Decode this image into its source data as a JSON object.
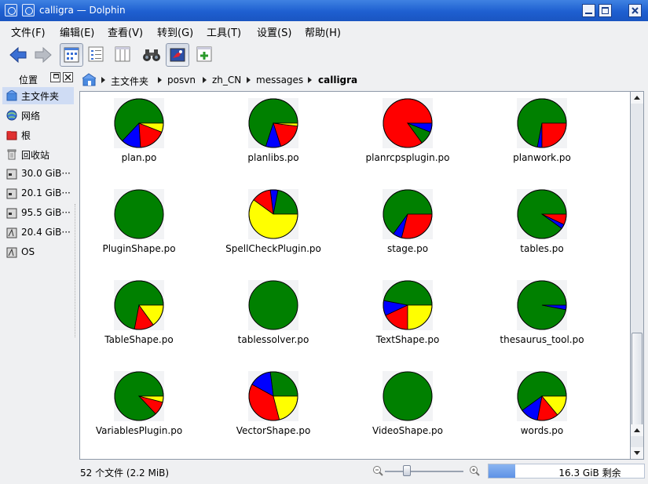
{
  "window": {
    "app_name": "calligra",
    "title_separator": "—",
    "app_title": "Dolphin"
  },
  "menu": [
    "文件(F)",
    "编辑(E)",
    "查看(V)",
    "转到(G)",
    "工具(T)",
    "设置(S)",
    "帮助(H)"
  ],
  "toolbar": {
    "icons": [
      "back-arrow-icon",
      "forward-arrow-icon",
      "icons-view-icon",
      "details-view-icon",
      "columns-view-icon",
      "find-binoculars-icon",
      "preview-icon",
      "split-view-icon"
    ]
  },
  "sidebar": {
    "title": "位置",
    "items": [
      {
        "label": "主文件夹",
        "icon": "home-folder-icon",
        "selected": true
      },
      {
        "label": "网络",
        "icon": "network-globe-icon"
      },
      {
        "label": "根",
        "icon": "root-folder-icon"
      },
      {
        "label": "回收站",
        "icon": "trash-icon"
      },
      {
        "label": "30.0 GiB···",
        "icon": "drive-icon"
      },
      {
        "label": "20.1 GiB···",
        "icon": "drive-icon"
      },
      {
        "label": "95.5 GiB···",
        "icon": "drive-icon"
      },
      {
        "label": "20.4 GiB···",
        "icon": "drive-icon"
      },
      {
        "label": "OS",
        "icon": "drive-icon"
      }
    ]
  },
  "breadcrumb": [
    "主文件夹",
    "posvn",
    "zh_CN",
    "messages",
    "calligra"
  ],
  "colors": {
    "green": "#008000",
    "red": "#ff0000",
    "blue": "#0000ff",
    "yellow": "#ffff00",
    "accent": "#1e5fd0"
  },
  "files": [
    {
      "name": "plan.po",
      "slices": [
        [
          "green",
          0.63
        ],
        [
          "blue",
          0.13
        ],
        [
          "red",
          0.18
        ],
        [
          "yellow",
          0.06
        ]
      ]
    },
    {
      "name": "planlibs.po",
      "slices": [
        [
          "green",
          0.7
        ],
        [
          "blue",
          0.1
        ],
        [
          "red",
          0.18
        ],
        [
          "yellow",
          0.02
        ]
      ]
    },
    {
      "name": "planrcpsplugin.po",
      "slices": [
        [
          "red",
          0.85
        ],
        [
          "green",
          0.09
        ],
        [
          "blue",
          0.06
        ]
      ]
    },
    {
      "name": "planwork.po",
      "slices": [
        [
          "green",
          0.72
        ],
        [
          "blue",
          0.03
        ],
        [
          "red",
          0.25
        ]
      ]
    },
    {
      "name": "PluginShape.po",
      "slices": [
        [
          "green",
          1.0
        ]
      ]
    },
    {
      "name": "SpellCheckPlugin.po",
      "slices": [
        [
          "green",
          0.22
        ],
        [
          "blue",
          0.05
        ],
        [
          "red",
          0.13
        ],
        [
          "yellow",
          0.6
        ]
      ]
    },
    {
      "name": "stage.po",
      "slices": [
        [
          "green",
          0.65
        ],
        [
          "blue",
          0.06
        ],
        [
          "red",
          0.29
        ]
      ]
    },
    {
      "name": "tables.po",
      "slices": [
        [
          "green",
          0.9
        ],
        [
          "blue",
          0.03
        ],
        [
          "red",
          0.07
        ]
      ]
    },
    {
      "name": "TableShape.po",
      "slices": [
        [
          "green",
          0.72
        ],
        [
          "red",
          0.13
        ],
        [
          "yellow",
          0.15
        ]
      ]
    },
    {
      "name": "tablessolver.po",
      "slices": [
        [
          "green",
          1.0
        ]
      ]
    },
    {
      "name": "TextShape.po",
      "slices": [
        [
          "green",
          0.47
        ],
        [
          "blue",
          0.1
        ],
        [
          "red",
          0.18
        ],
        [
          "yellow",
          0.25
        ]
      ]
    },
    {
      "name": "thesaurus_tool.po",
      "slices": [
        [
          "green",
          0.97
        ],
        [
          "blue",
          0.03
        ]
      ]
    },
    {
      "name": "VariablesPlugin.po",
      "slices": [
        [
          "green",
          0.87
        ],
        [
          "red",
          0.09
        ],
        [
          "yellow",
          0.04
        ]
      ]
    },
    {
      "name": "VectorShape.po",
      "slices": [
        [
          "green",
          0.27
        ],
        [
          "blue",
          0.15
        ],
        [
          "red",
          0.37
        ],
        [
          "yellow",
          0.21
        ]
      ]
    },
    {
      "name": "VideoShape.po",
      "slices": [
        [
          "green",
          1.0
        ]
      ]
    },
    {
      "name": "words.po",
      "slices": [
        [
          "green",
          0.6
        ],
        [
          "blue",
          0.12
        ],
        [
          "red",
          0.14
        ],
        [
          "yellow",
          0.14
        ]
      ]
    }
  ],
  "status": {
    "file_count_text": "52 个文件 (2.2 MiB)",
    "free_space_text": "16.3 GiB 剩余",
    "disk_used_fraction": 0.17,
    "zoom_fraction": 0.25
  }
}
